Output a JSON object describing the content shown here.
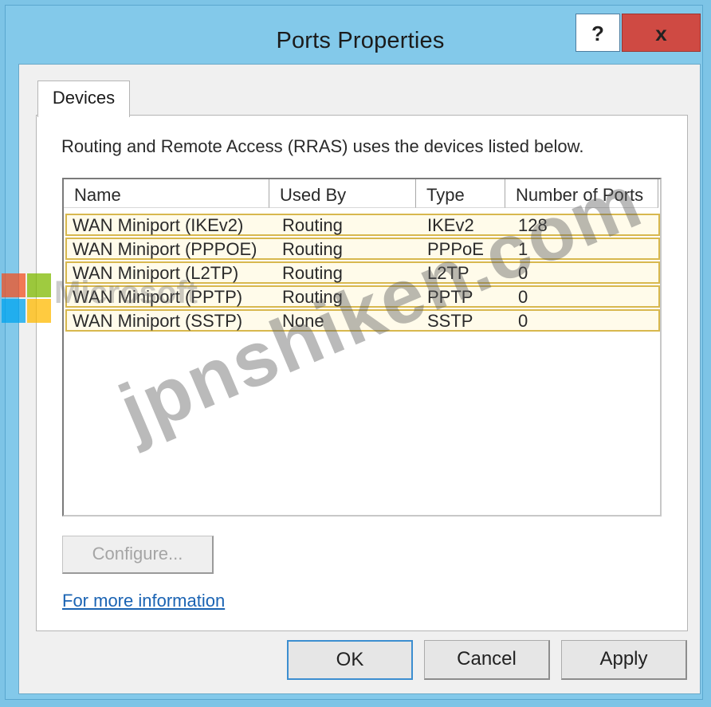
{
  "window": {
    "title": "Ports Properties",
    "help_label": "?",
    "close_label": "x"
  },
  "tabs": [
    {
      "label": "Devices"
    }
  ],
  "devices": {
    "description": "Routing and Remote Access (RRAS) uses the devices listed below.",
    "columns": [
      "Name",
      "Used By",
      "Type",
      "Number of Ports"
    ],
    "rows": [
      {
        "name": "WAN Miniport (IKEv2)",
        "used_by": "Routing",
        "type": "IKEv2",
        "ports": "128"
      },
      {
        "name": "WAN Miniport (PPPOE)",
        "used_by": "Routing",
        "type": "PPPoE",
        "ports": "1"
      },
      {
        "name": "WAN Miniport (L2TP)",
        "used_by": "Routing",
        "type": "L2TP",
        "ports": "0"
      },
      {
        "name": "WAN Miniport (PPTP)",
        "used_by": "Routing",
        "type": "PPTP",
        "ports": "0"
      },
      {
        "name": "WAN Miniport (SSTP)",
        "used_by": "None",
        "type": "SSTP",
        "ports": "0"
      }
    ],
    "configure_label": "Configure...",
    "more_info_link": "For more information"
  },
  "footer": {
    "ok_label": "OK",
    "cancel_label": "Cancel",
    "apply_label": "Apply"
  },
  "watermark": {
    "text": "jpnshiken.com",
    "logo_text": "Microsoft",
    "logo_colors": [
      "#f25022",
      "#7fba00",
      "#00a4ef",
      "#ffb900"
    ]
  },
  "colors": {
    "title_bar": "#83c9ea",
    "close_button": "#cf4a43",
    "row_highlight_border": "#d8b84e",
    "link": "#1a63b3"
  }
}
